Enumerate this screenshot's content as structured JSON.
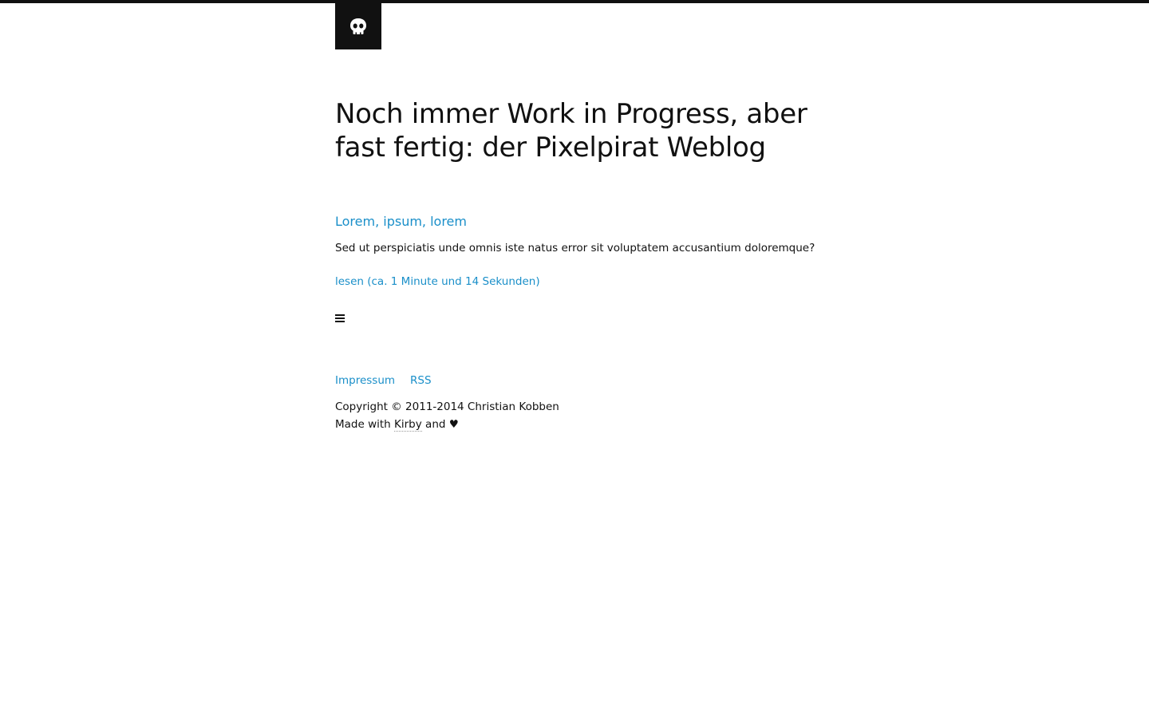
{
  "logo": {
    "icon": "skull-icon"
  },
  "header": {
    "title": "Noch immer Work in Progress, aber fast fertig: der Pixelpirat Weblog"
  },
  "article": {
    "title": "Lorem, ipsum, lorem",
    "excerpt": "Sed ut perspiciatis unde omnis iste natus error sit voluptatem accusantium doloremque?",
    "read_link": "lesen (ca. 1 Minute und 14 Sekunden)"
  },
  "menu": {
    "icon": "hamburger-menu-icon"
  },
  "footer": {
    "nav": {
      "impressum": "Impressum",
      "rss": "RSS"
    },
    "copyright": "Copyright © 2011-2014 Christian Kobben",
    "made_with_prefix": "Made with",
    "made_with_link": "Kirby",
    "made_with_suffix": "and ♥"
  },
  "colors": {
    "accent": "#1a8fc9",
    "text": "#111111",
    "background": "#ffffff"
  }
}
